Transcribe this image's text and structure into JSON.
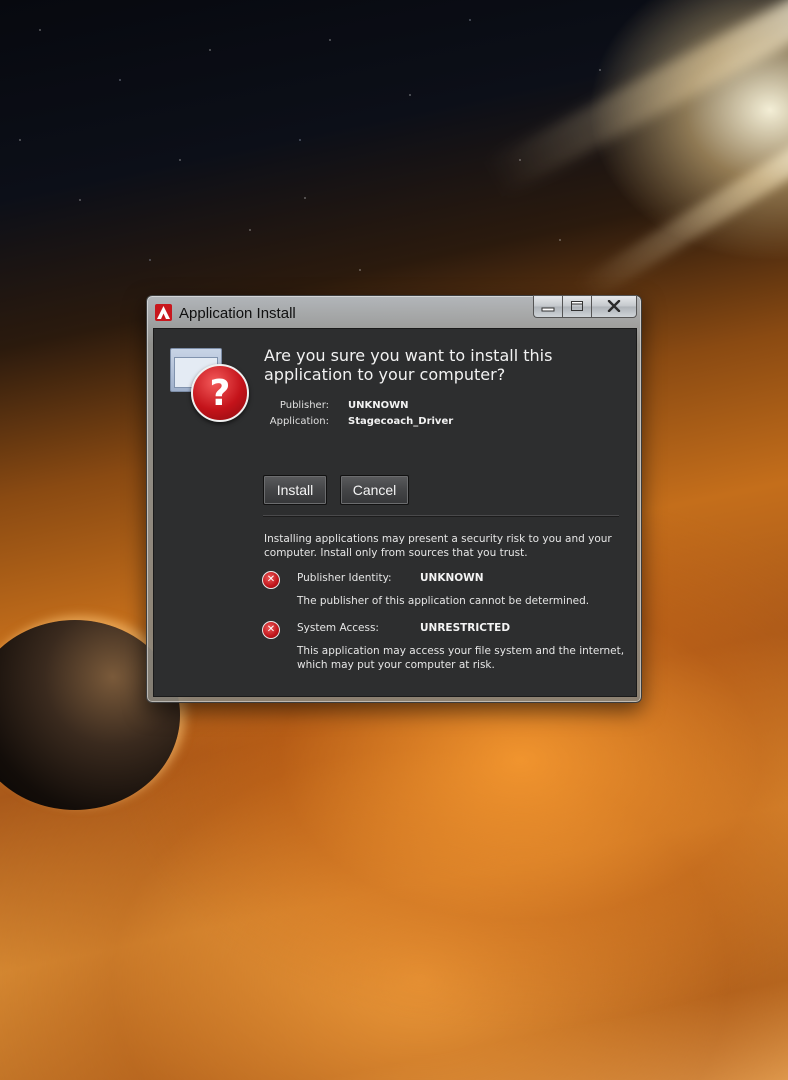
{
  "window": {
    "title": "Application Install",
    "controls": {
      "minimize": "minimize-icon",
      "maximize": "maximize-icon",
      "close": "close-icon"
    }
  },
  "dialog": {
    "heading": "Are you sure you want to install this application to your computer?",
    "publisher_label": "Publisher:",
    "publisher_value": "UNKNOWN",
    "application_label": "Application:",
    "application_value": "Stagecoach_Driver",
    "install_label": "Install",
    "cancel_label": "Cancel",
    "warning_text": "Installing applications may present a security risk to you and your computer. Install only from sources that you trust.",
    "risks": [
      {
        "label": "Publisher Identity:",
        "value": "UNKNOWN",
        "description": "The publisher of this application cannot be determined."
      },
      {
        "label": "System Access:",
        "value": "UNRESTRICTED",
        "description": "This application may access your file system and the internet, which may put your computer at risk."
      }
    ]
  },
  "colors": {
    "dialog_bg": "#2d2e2f",
    "warning_red": "#c4131a",
    "text": "#f2f2f2"
  }
}
